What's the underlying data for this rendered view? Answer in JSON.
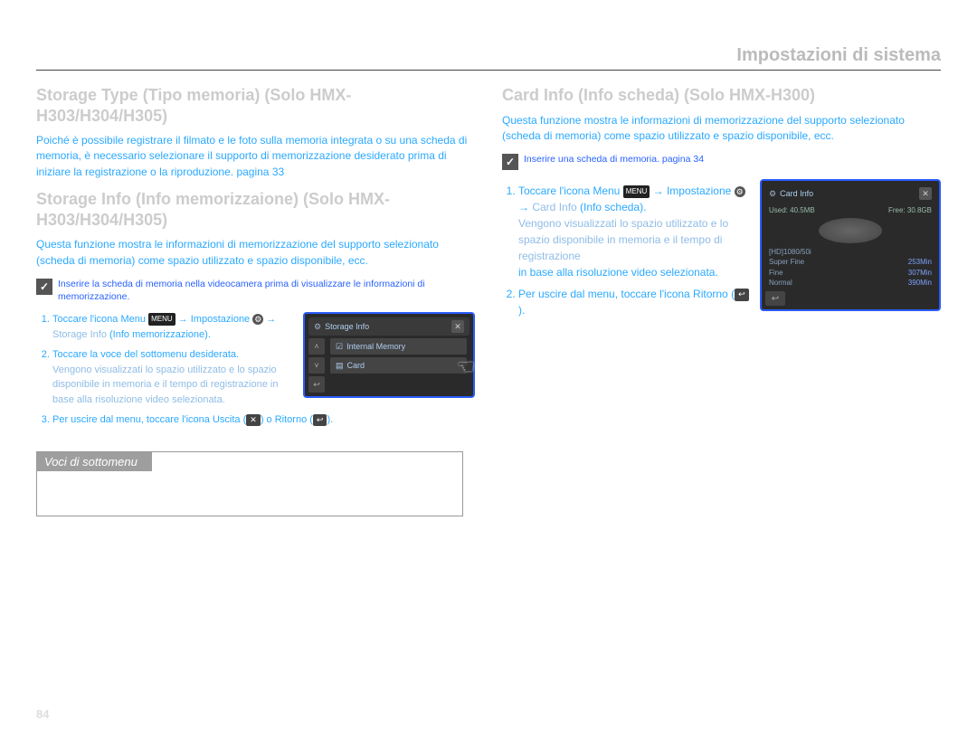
{
  "header": "Impostazioni di sistema",
  "page_number": "84",
  "left": {
    "h2a": "Storage Type (Tipo memoria) (Solo",
    "h2a_tail": "HMX-H303/H304/H305)",
    "p1": "Poiché è possibile registrare il filmato e le foto sulla memoria integrata o su una scheda di memoria, è necessario selezionare il supporto di memorizzazione desiderato prima di iniziare la registrazione o la riproduzione. pagina 33",
    "h2b": "Storage Info (Info memorizzaione) (Solo HMX-H303/H304/H305)",
    "p2": "Questa funzione mostra le informazioni di memorizzazione del supporto selezionato (scheda di memoria) come spazio utilizzato e spazio disponibile, ecc.",
    "note": "Inserire la scheda di memoria nella videocamera prima di visualizzare le informazioni di memorizzazione.",
    "steps": [
      "Toccare l'icona Menu",
      "Impostazione",
      "Storage Info",
      "(Info memorizzazione).",
      "Toccare la voce del sottomenu desiderata.",
      "Vengono visualizzati lo spazio utilizzato e lo spazio disponibile in memoria e il tempo di registrazione in base alla risoluzione video selezionata.",
      "Per uscire dal menu, toccare l'icona Uscita",
      "o Ritorno"
    ],
    "menu_label": "MENU",
    "gear_glyph": "⚙",
    "exit_glyph": "✕",
    "return_glyph": "↩",
    "submenus_header": "Voci di sottomenu",
    "screenshot": {
      "title": "Storage Info",
      "option1": "Internal Memory",
      "option2": "Card",
      "up": "˄",
      "down": "˅",
      "back": "↩",
      "close": "✕",
      "gear": "⚙",
      "check": "☑",
      "sd": "▤"
    }
  },
  "right": {
    "h2": "Card Info (Info scheda) (Solo HMX-H300)",
    "p1": "Questa funzione mostra le informazioni di memorizzazione del supporto selezionato (scheda di memoria) come spazio utilizzato e spazio disponibile, ecc.",
    "note": "Inserire una scheda di memoria. pagina 34",
    "steps": {
      "s1_a": "Toccare l'icona Menu",
      "s1_b": "Impostazione",
      "s1_c": "Card Info",
      "s1_d": "(Info scheda).",
      "s1_sub": "Vengono visualizzati lo spazio utilizzato e lo spazio disponibile in memoria e il tempo di registrazione",
      "s1_tail": "in base alla risoluzione video selezionata.",
      "s2": "Per uscire dal menu, toccare l'icona Ritorno"
    },
    "menu_label": "MENU",
    "gear_glyph": "⚙",
    "return_glyph": "↩",
    "cardinfo": {
      "title": "Card Info",
      "used": "Used: 40.5MB",
      "free": "Free: 30.8GB",
      "row1_label": "[HD]1080/50i",
      "row2_label": "Super Fine",
      "row2_val": "253Min",
      "row3_label": "Fine",
      "row3_val": "307Min",
      "row4_label": "Normal",
      "row4_val": "390Min",
      "close": "✕",
      "gear": "⚙",
      "back": "↩"
    }
  }
}
